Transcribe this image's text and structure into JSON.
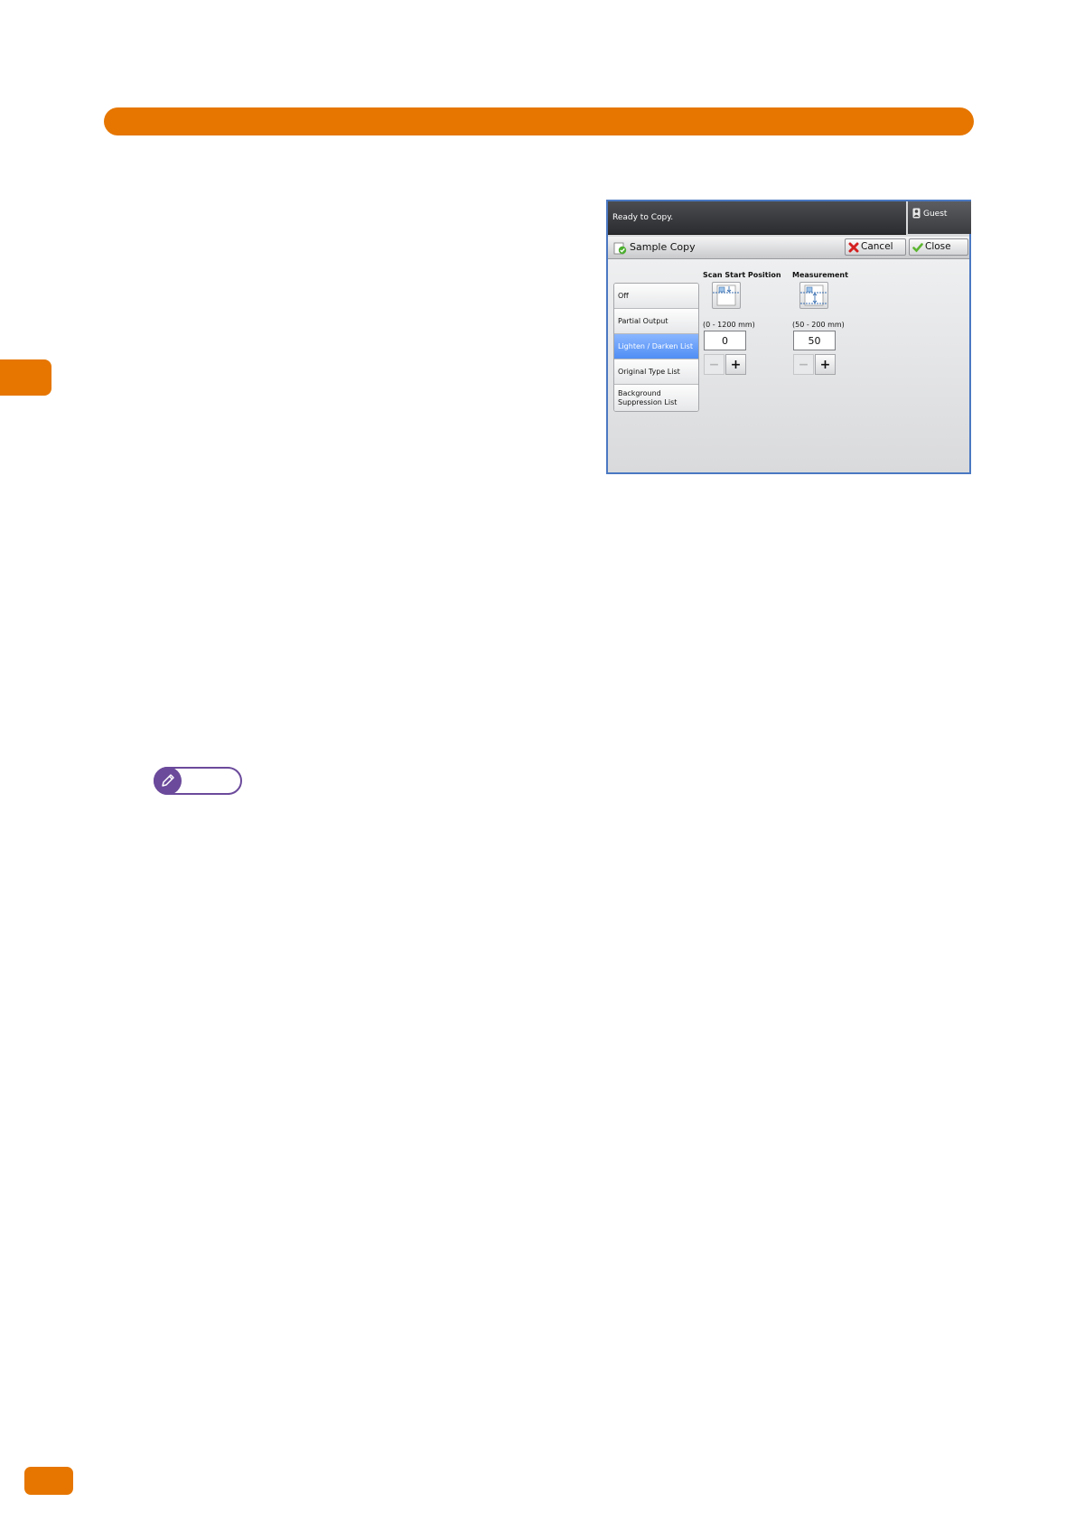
{
  "page": {
    "accent_color": "#e67600",
    "note_color": "#6b4a9b"
  },
  "device": {
    "status_text": "Ready to Copy.",
    "user_label": "Guest",
    "title": "Sample Copy",
    "cancel_label": "Cancel",
    "close_label": "Close",
    "menu_items": [
      {
        "label": "Off",
        "selected": false
      },
      {
        "label": "Partial Output",
        "selected": false
      },
      {
        "label": "Lighten / Darken List",
        "selected": true
      },
      {
        "label": "Original Type List",
        "selected": false
      },
      {
        "label": "Background Suppression List",
        "selected": false
      }
    ],
    "scan_start": {
      "label": "Scan Start Position",
      "range": "(0 - 1200 mm)",
      "value": "0",
      "minus": "−",
      "plus": "+"
    },
    "measurement": {
      "label": "Measurement",
      "range": "(50 - 200 mm)",
      "value": "50",
      "minus": "−",
      "plus": "+"
    }
  }
}
